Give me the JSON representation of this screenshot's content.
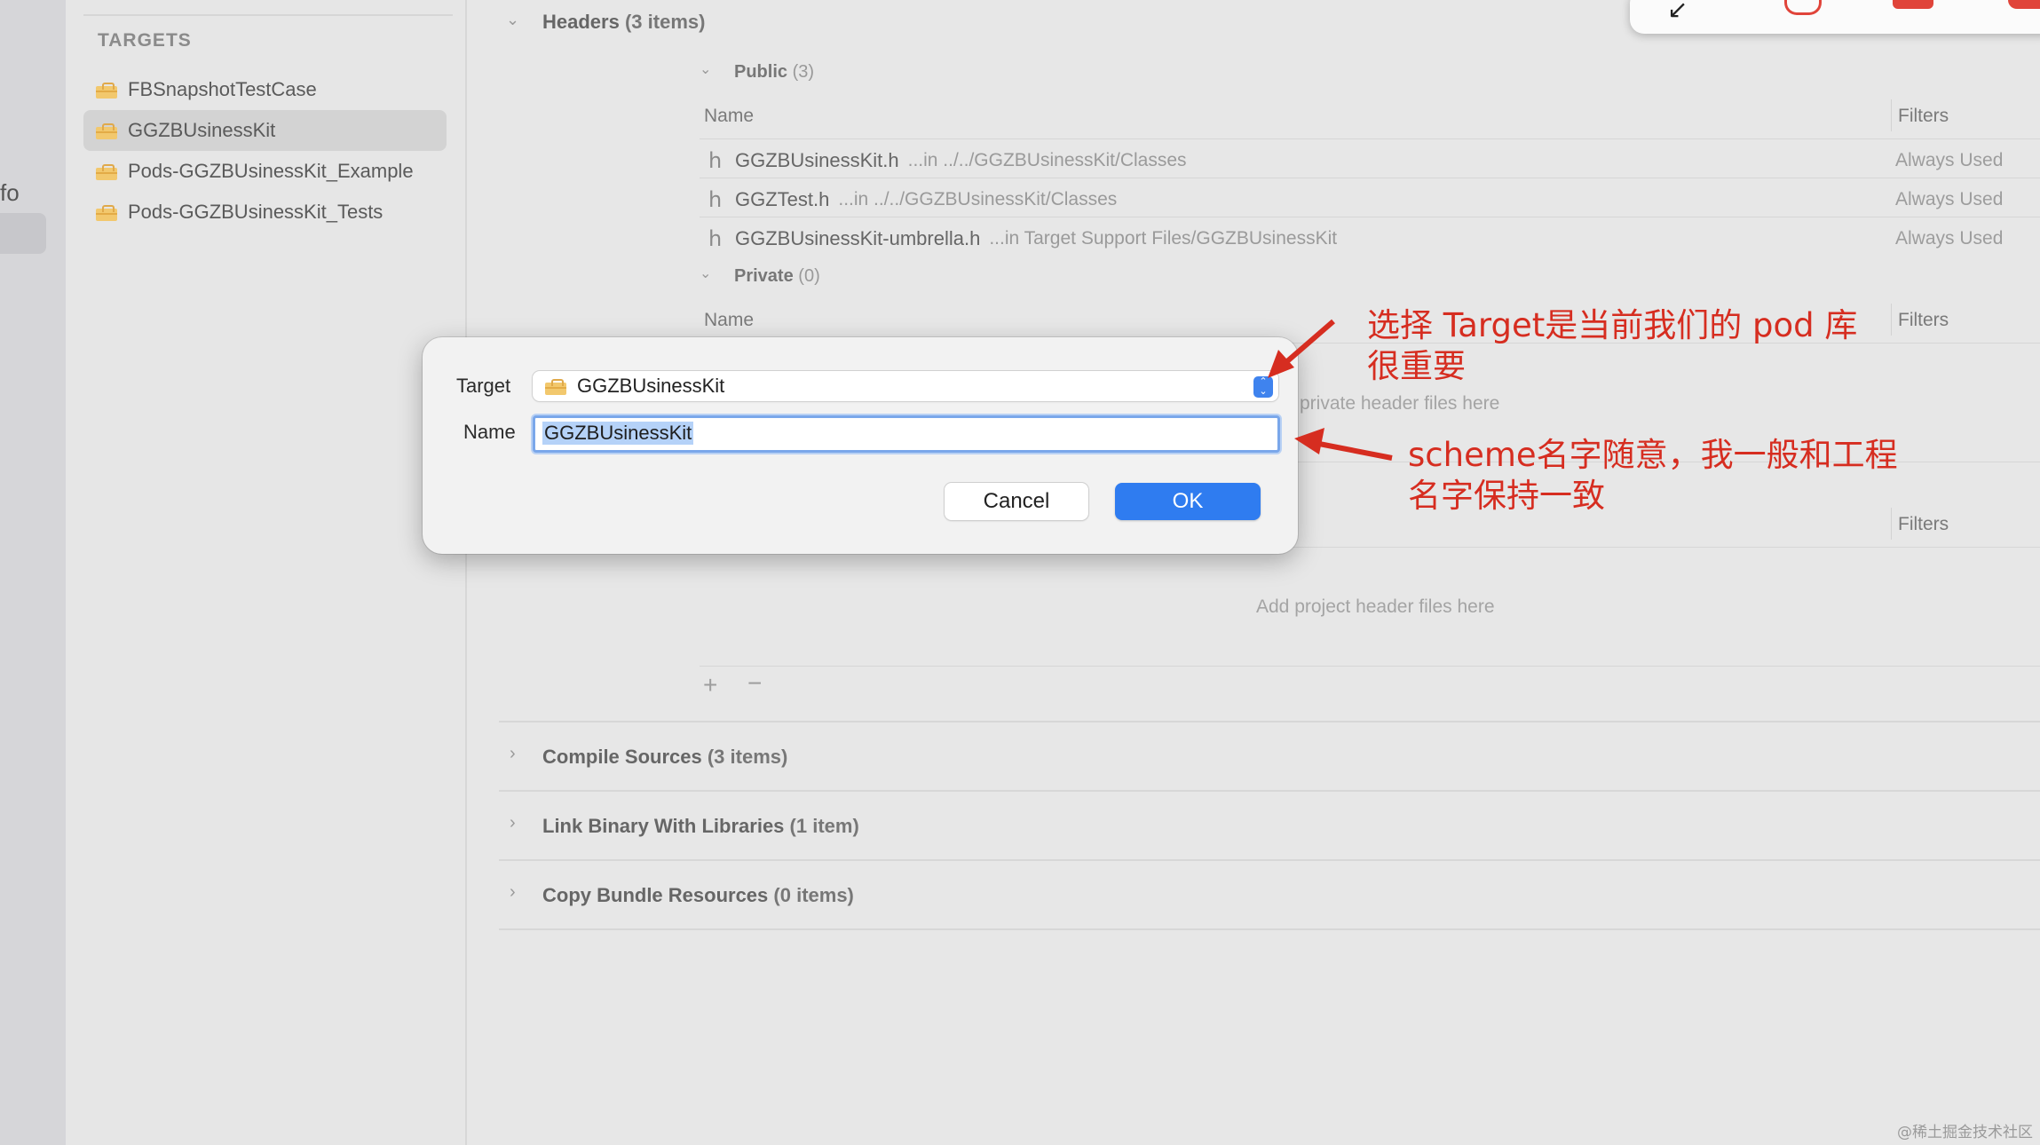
{
  "left_strip": {
    "info_text": "fo"
  },
  "targets": {
    "header": "TARGETS",
    "items": [
      {
        "label": "FBSnapshotTestCase",
        "selected": false
      },
      {
        "label": "GGZBUsinessKit",
        "selected": true
      },
      {
        "label": "Pods-GGZBUsinessKit_Example",
        "selected": false
      },
      {
        "label": "Pods-GGZBUsinessKit_Tests",
        "selected": false
      }
    ]
  },
  "headers_phase": {
    "title": "Headers",
    "count": "(3 items)",
    "public": {
      "title": "Public",
      "count": "(3)",
      "col_name": "Name",
      "col_filters": "Filters",
      "files": [
        {
          "name": "GGZBUsinessKit.h",
          "path": "...in ../../GGZBUsinessKit/Classes",
          "filter": "Always Used"
        },
        {
          "name": "GGZTest.h",
          "path": "...in ../../GGZBUsinessKit/Classes",
          "filter": "Always Used"
        },
        {
          "name": "GGZBUsinessKit-umbrella.h",
          "path": "...in Target Support Files/GGZBUsinessKit",
          "filter": "Always Used"
        }
      ],
      "file_icon": "h"
    },
    "private": {
      "title": "Private",
      "count": "(0)",
      "col_name": "Name",
      "col_filters": "Filters",
      "placeholder": "private header files here"
    },
    "project": {
      "col_filters": "Filters",
      "placeholder": "Add project header files here"
    },
    "add_label": "+",
    "remove_label": "−"
  },
  "phases": [
    {
      "title": "Compile Sources",
      "count": "(3 items)"
    },
    {
      "title": "Link Binary With Libraries",
      "count": "(1 item)"
    },
    {
      "title": "Copy Bundle Resources",
      "count": "(0 items)"
    }
  ],
  "dialog": {
    "target_label": "Target",
    "target_value": "GGZBUsinessKit",
    "name_label": "Name",
    "name_value": "GGZBUsinessKit",
    "cancel_label": "Cancel",
    "ok_label": "OK"
  },
  "annotations": {
    "target_note_line1": "选择 Target是当前我们的 pod 库",
    "target_note_line2": "很重要",
    "name_note_line1": "scheme名字随意，我一般和工程",
    "name_note_line2": "名字保持一致",
    "color": "#d62d20"
  },
  "top_popup": {
    "icons": [
      "collapse-arrow-icon",
      "mic-off-icon",
      "camera-off-icon",
      "stop-icon"
    ]
  },
  "watermark": "@稀土掘金技术社区",
  "colors": {
    "accent": "#2f7cf0",
    "annotation": "#d62d20",
    "target_icon": "#f2c86d"
  }
}
